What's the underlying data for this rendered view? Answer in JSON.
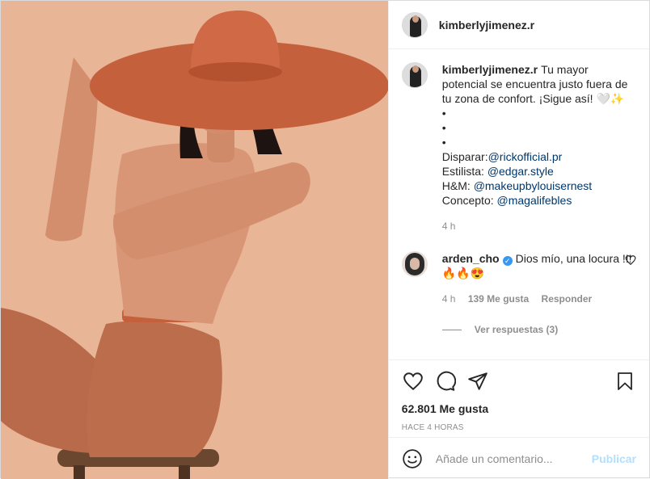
{
  "post": {
    "author": "kimberlyjimenez.r",
    "caption": {
      "username": "kimberlyjimenez.r",
      "text": "Tu mayor potencial se encuentra justo fuera de tu zona de confort. ¡Sigue así! 🤍✨",
      "bullets": [
        "•",
        "•",
        "•"
      ],
      "credits": [
        {
          "label": "Disparar:",
          "handle": "@rickofficial.pr"
        },
        {
          "label": "Estilista: ",
          "handle": "@edgar.style"
        },
        {
          "label": "H&M: ",
          "handle": "@makeupbylouisernest"
        },
        {
          "label": "Concepto: ",
          "handle": "@magalifebles"
        }
      ],
      "time": "4 h"
    },
    "comments": [
      {
        "username": "arden_cho",
        "verified_icon": "verified-badge-icon",
        "text": "Dios mío, una locura !!! 🔥🔥😍",
        "time": "4 h",
        "likes": "139 Me gusta",
        "reply": "Responder",
        "view_replies": "Ver respuestas (3)"
      }
    ],
    "actions": {
      "icons": [
        "heart-icon",
        "comment-icon",
        "share-icon",
        "bookmark-icon"
      ],
      "likes": "62.801 Me gusta",
      "posted": "HACE 4 HORAS"
    },
    "add_comment": {
      "placeholder": "Añade un comentario...",
      "publish": "Publicar"
    }
  },
  "colors": {
    "link": "#00376b",
    "muted": "#8e8e8e",
    "publish_disabled": "#b2dffc",
    "verified": "#3897f0",
    "photo_background": "#e8b596",
    "hat": "#c5603d"
  }
}
